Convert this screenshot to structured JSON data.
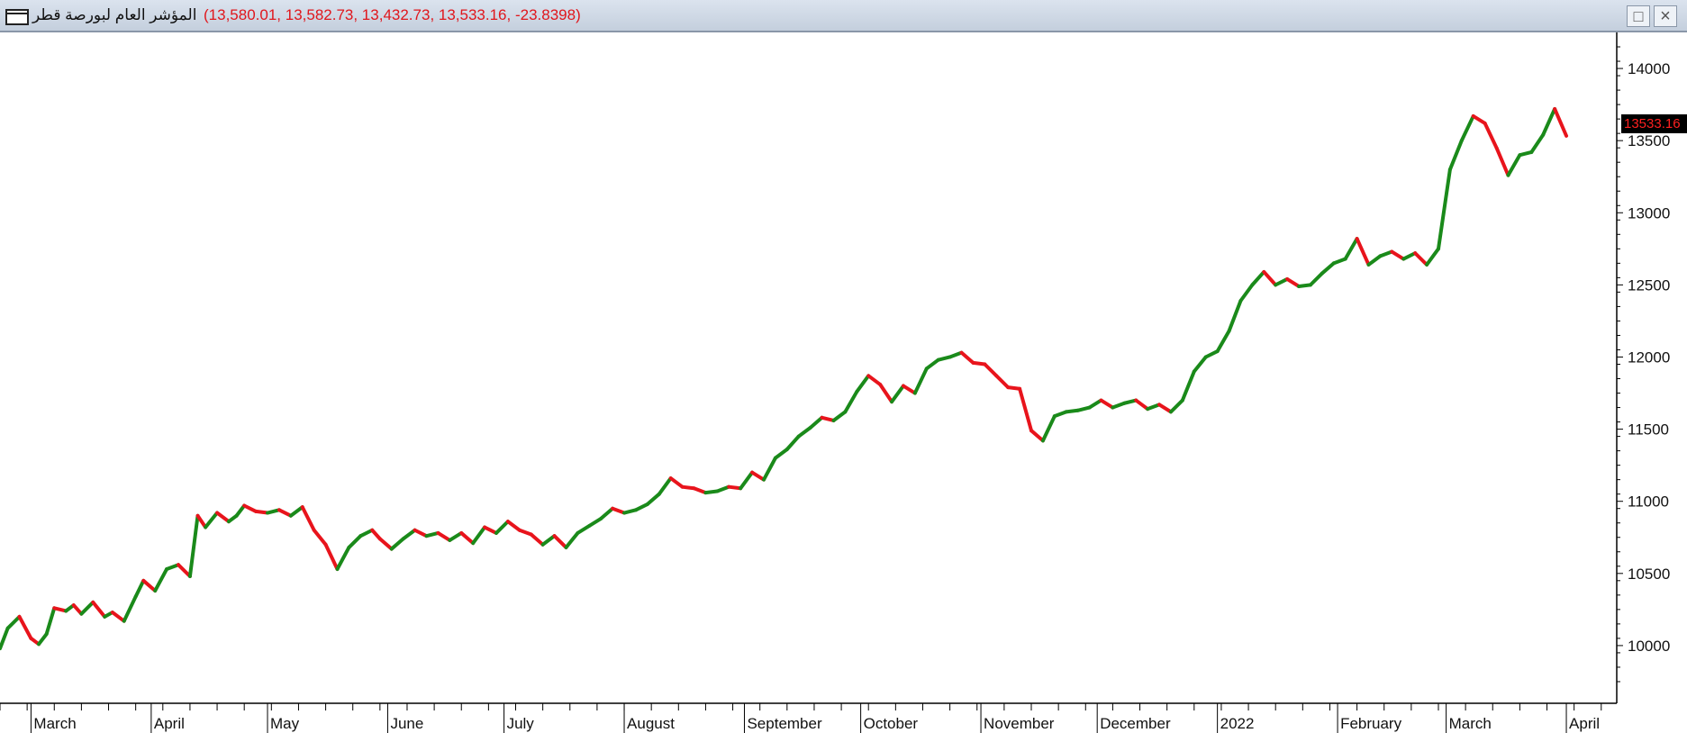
{
  "window": {
    "title": "المؤشر العام لبورصة قطر",
    "values_readout": "(13,580.01, 13,582.73, 13,432.73, 13,533.16, -23.8398)",
    "icons": [
      "window-menu-icon",
      "restore-icon",
      "close-icon"
    ]
  },
  "colors": {
    "up": "#1a8a1a",
    "down": "#e8141c",
    "price_tag_bg": "#000000",
    "price_tag_text": "#ff2020"
  },
  "chart_data": {
    "type": "line",
    "title": "المؤشر العام لبورصة قطر",
    "xlabel": "",
    "ylabel": "",
    "ylim": [
      9600,
      14250
    ],
    "y_ticks": [
      10000,
      10500,
      11000,
      11500,
      12000,
      12500,
      13000,
      13500,
      14000
    ],
    "y_tick_labels": [
      "10000",
      "10500",
      "11000",
      "11500",
      "12000",
      "12500",
      "13000",
      "13500",
      "14000"
    ],
    "x_tick_labels": [
      "March",
      "April",
      "May",
      "June",
      "July",
      "August",
      "September",
      "October",
      "November",
      "December",
      "2022",
      "February",
      "March",
      "April"
    ],
    "x_label_dates": [
      "2021-03-01",
      "2021-04-01",
      "2021-05-01",
      "2021-06-01",
      "2021-07-01",
      "2021-08-01",
      "2021-09-01",
      "2021-10-01",
      "2021-11-01",
      "2021-12-01",
      "2022-01-01",
      "2022-02-01",
      "2022-03-01",
      "2022-04-01"
    ],
    "x_range": [
      "2021-02-21",
      "2022-04-14"
    ],
    "last_price_label": "13533.16",
    "series": [
      {
        "x": [
          "2021-02-21",
          "2021-02-23",
          "2021-02-26",
          "2021-03-01",
          "2021-03-03",
          "2021-03-05",
          "2021-03-07",
          "2021-03-10",
          "2021-03-12",
          "2021-03-14",
          "2021-03-17",
          "2021-03-20",
          "2021-03-22",
          "2021-03-25",
          "2021-03-28",
          "2021-03-30",
          "2021-04-02",
          "2021-04-05",
          "2021-04-08",
          "2021-04-11",
          "2021-04-13",
          "2021-04-15",
          "2021-04-18",
          "2021-04-21",
          "2021-04-23",
          "2021-04-25",
          "2021-04-28",
          "2021-05-01",
          "2021-05-04",
          "2021-05-07",
          "2021-05-10",
          "2021-05-13",
          "2021-05-16",
          "2021-05-19",
          "2021-05-22",
          "2021-05-25",
          "2021-05-28",
          "2021-05-30",
          "2021-06-02",
          "2021-06-05",
          "2021-06-08",
          "2021-06-11",
          "2021-06-14",
          "2021-06-17",
          "2021-06-20",
          "2021-06-23",
          "2021-06-26",
          "2021-06-29",
          "2021-07-02",
          "2021-07-05",
          "2021-07-08",
          "2021-07-11",
          "2021-07-14",
          "2021-07-17",
          "2021-07-20",
          "2021-07-23",
          "2021-07-26",
          "2021-07-29",
          "2021-08-01",
          "2021-08-04",
          "2021-08-07",
          "2021-08-10",
          "2021-08-13",
          "2021-08-16",
          "2021-08-19",
          "2021-08-22",
          "2021-08-25",
          "2021-08-28",
          "2021-08-31",
          "2021-09-03",
          "2021-09-06",
          "2021-09-09",
          "2021-09-12",
          "2021-09-15",
          "2021-09-18",
          "2021-09-21",
          "2021-09-24",
          "2021-09-27",
          "2021-09-30",
          "2021-10-03",
          "2021-10-06",
          "2021-10-09",
          "2021-10-12",
          "2021-10-15",
          "2021-10-18",
          "2021-10-21",
          "2021-10-24",
          "2021-10-27",
          "2021-10-30",
          "2021-11-02",
          "2021-11-05",
          "2021-11-08",
          "2021-11-11",
          "2021-11-14",
          "2021-11-17",
          "2021-11-20",
          "2021-11-23",
          "2021-11-26",
          "2021-11-29",
          "2021-12-02",
          "2021-12-05",
          "2021-12-08",
          "2021-12-11",
          "2021-12-14",
          "2021-12-17",
          "2021-12-20",
          "2021-12-23",
          "2021-12-26",
          "2021-12-29",
          "2022-01-01",
          "2022-01-04",
          "2022-01-07",
          "2022-01-10",
          "2022-01-13",
          "2022-01-16",
          "2022-01-19",
          "2022-01-22",
          "2022-01-25",
          "2022-01-28",
          "2022-01-31",
          "2022-02-03",
          "2022-02-06",
          "2022-02-09",
          "2022-02-12",
          "2022-02-15",
          "2022-02-18",
          "2022-02-21",
          "2022-02-24",
          "2022-02-27",
          "2022-03-02",
          "2022-03-05",
          "2022-03-08",
          "2022-03-11",
          "2022-03-14",
          "2022-03-17",
          "2022-03-20",
          "2022-03-23",
          "2022-03-26",
          "2022-03-29",
          "2022-04-01"
        ],
        "y": [
          9980,
          10120,
          10200,
          10050,
          10010,
          10080,
          10260,
          10240,
          10280,
          10220,
          10300,
          10200,
          10230,
          10170,
          10340,
          10450,
          10380,
          10530,
          10560,
          10480,
          10900,
          10820,
          10920,
          10860,
          10900,
          10970,
          10930,
          10920,
          10940,
          10900,
          10960,
          10800,
          10700,
          10530,
          10680,
          10760,
          10800,
          10740,
          10670,
          10740,
          10800,
          10760,
          10780,
          10730,
          10780,
          10710,
          10820,
          10780,
          10860,
          10800,
          10770,
          10700,
          10760,
          10680,
          10780,
          10830,
          10880,
          10950,
          10920,
          10940,
          10980,
          11050,
          11160,
          11100,
          11090,
          11060,
          11070,
          11100,
          11090,
          11200,
          11150,
          11300,
          11360,
          11450,
          11510,
          11580,
          11560,
          11620,
          11760,
          11870,
          11810,
          11690,
          11800,
          11750,
          11920,
          11980,
          12000,
          12030,
          11960,
          11950,
          11870,
          11790,
          11780,
          11490,
          11420,
          11590,
          11620,
          11630,
          11650,
          11700,
          11650,
          11680,
          11700,
          11640,
          11670,
          11620,
          11700,
          11900,
          12000,
          12040,
          12180,
          12390,
          12500,
          12590,
          12500,
          12540,
          12490,
          12500,
          12580,
          12650,
          12680,
          12820,
          12640,
          12700,
          12730,
          12680,
          12720,
          12640,
          12750,
          13300,
          13500,
          13670,
          13620,
          13450,
          13260,
          13400,
          13420,
          13540,
          13720,
          13533
        ]
      }
    ]
  }
}
